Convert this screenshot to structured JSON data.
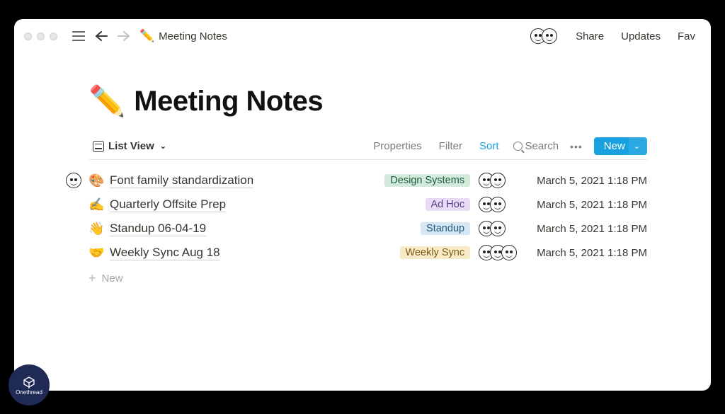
{
  "topbar": {
    "breadcrumb_emoji": "✏️",
    "breadcrumb_title": "Meeting Notes",
    "links": {
      "share": "Share",
      "updates": "Updates",
      "fav": "Fav"
    }
  },
  "page": {
    "title_emoji": "✏️",
    "title": "Meeting Notes"
  },
  "viewbar": {
    "view_label": "List View",
    "properties": "Properties",
    "filter": "Filter",
    "sort": "Sort",
    "search": "Search",
    "new_label": "New"
  },
  "rows": [
    {
      "emoji": "🎨",
      "title": "Font family standardization",
      "tag_label": "Design Systems",
      "tag_class": "tag-green",
      "date": "March 5, 2021 1:18 PM",
      "faces": 2,
      "show_page_avatar": true
    },
    {
      "emoji": "✍️",
      "title": "Quarterly Offsite Prep",
      "tag_label": "Ad Hoc",
      "tag_class": "tag-purple",
      "date": "March 5, 2021 1:18 PM",
      "faces": 2,
      "show_page_avatar": false
    },
    {
      "emoji": "👋",
      "title": "Standup 06-04-19",
      "tag_label": "Standup",
      "tag_class": "tag-blue",
      "date": "March 5, 2021 1:18 PM",
      "faces": 2,
      "show_page_avatar": false
    },
    {
      "emoji": "🤝",
      "title": "Weekly Sync Aug 18",
      "tag_label": "Weekly Sync",
      "tag_class": "tag-yellow",
      "date": "March 5, 2021 1:18 PM",
      "faces": 3,
      "show_page_avatar": false
    }
  ],
  "new_row_label": "New",
  "brand_label": "Onethread"
}
